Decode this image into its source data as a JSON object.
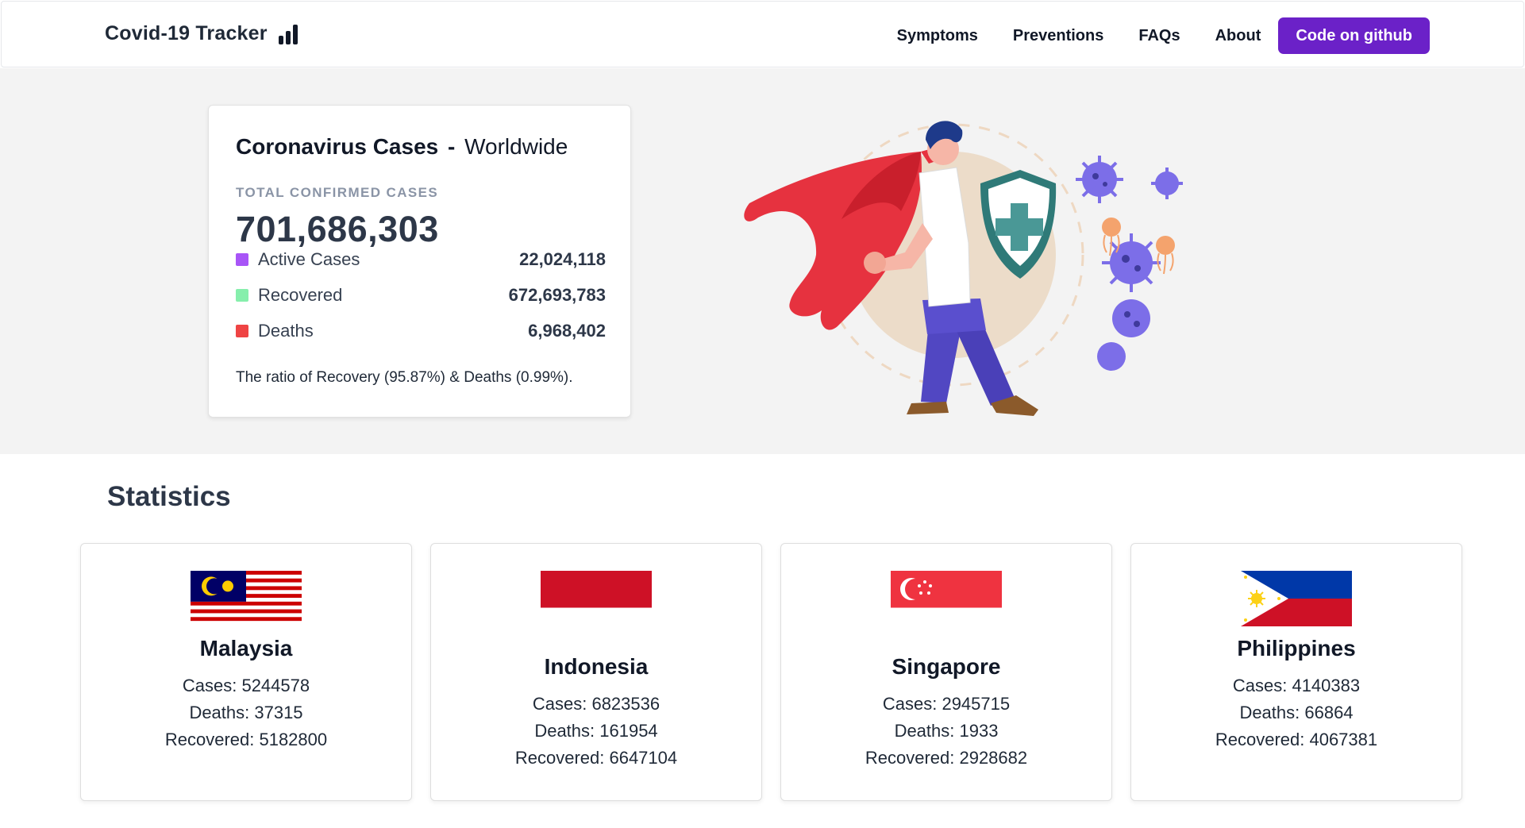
{
  "header": {
    "brand": "Covid-19 Tracker",
    "nav": [
      "Symptoms",
      "Preventions",
      "FAQs",
      "About"
    ],
    "github_label": "Code on github"
  },
  "summary": {
    "title": "Coronavirus Cases",
    "separator": "-",
    "scope": "Worldwide",
    "total_label": "TOTAL CONFIRMED CASES",
    "total": "701,686,303",
    "active_label": "Active Cases",
    "active": "22,024,118",
    "recovered_label": "Recovered",
    "recovered": "672,693,783",
    "deaths_label": "Deaths",
    "deaths": "6,968,402",
    "ratio_text": "The ratio of Recovery (95.87%) & Deaths (0.99%).",
    "colors": {
      "active": "#a855f7",
      "recovered": "#86efac",
      "deaths": "#ef4444"
    }
  },
  "statistics": {
    "title": "Statistics",
    "countries": [
      {
        "name": "Malaysia",
        "cases": "Cases: 5244578",
        "deaths": "Deaths: 37315",
        "recovered": "Recovered: 5182800"
      },
      {
        "name": "Indonesia",
        "cases": "Cases: 6823536",
        "deaths": "Deaths: 161954",
        "recovered": "Recovered: 6647104"
      },
      {
        "name": "Singapore",
        "cases": "Cases: 2945715",
        "deaths": "Deaths: 1933",
        "recovered": "Recovered: 2928682"
      },
      {
        "name": "Philippines",
        "cases": "Cases: 4140383",
        "deaths": "Deaths: 66864",
        "recovered": "Recovered: 4067381"
      }
    ]
  },
  "icons": {
    "brand": "bar-chart-icon",
    "hero": "superhero-shield-virus-illustration"
  }
}
